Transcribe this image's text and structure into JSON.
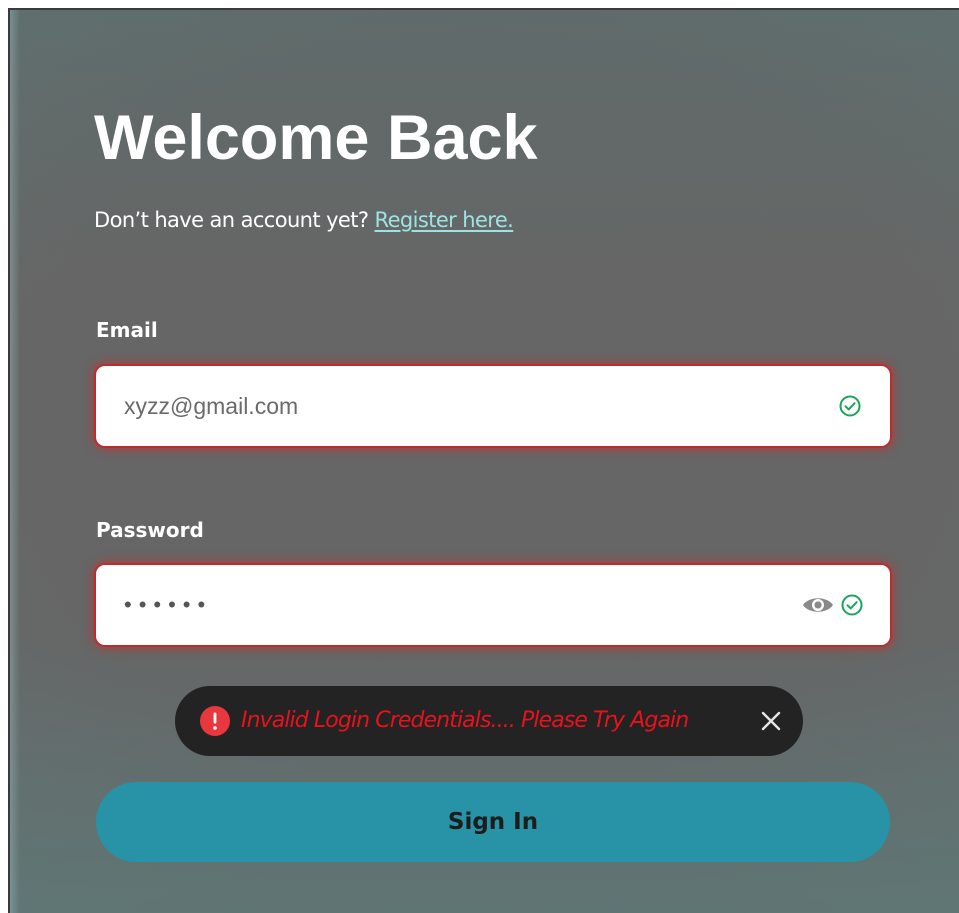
{
  "header": {
    "title": "Welcome Back",
    "register_prompt": "Don’t have an account yet?",
    "register_link": "Register here."
  },
  "form": {
    "email": {
      "label": "Email",
      "value": "xyzz@gmail.com",
      "status_icon": "check-circle-icon"
    },
    "password": {
      "label": "Password",
      "value": "••••••",
      "toggle_icon": "eye-icon",
      "status_icon": "check-circle-icon"
    },
    "submit_label": "Sign In"
  },
  "toast": {
    "icon": "alert-icon",
    "message": "Invalid Login Credentials.... Please Try Again",
    "close_icon": "close-icon"
  },
  "colors": {
    "accent": "#2893a6",
    "link": "#9ee3e3",
    "error": "#e8121c",
    "success": "#1aa55a",
    "toast_bg": "#232323"
  }
}
